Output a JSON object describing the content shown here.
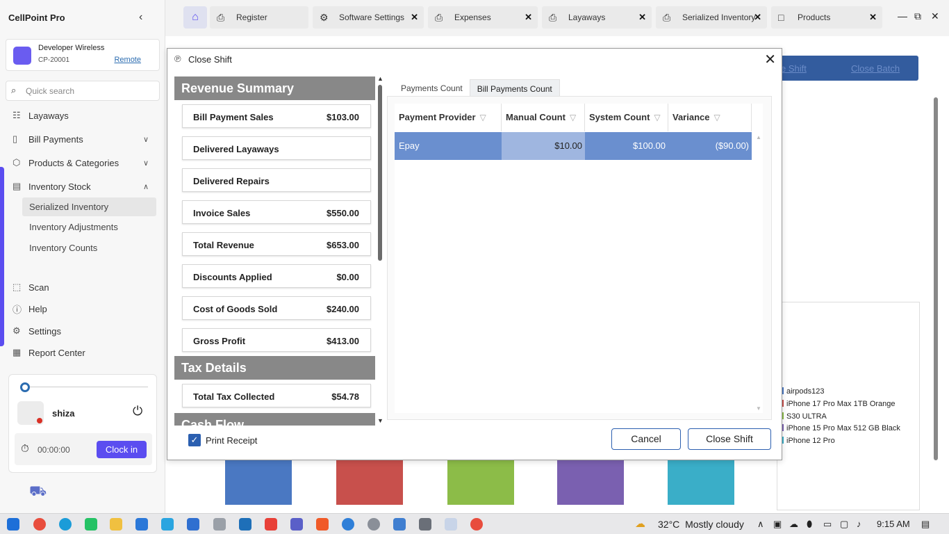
{
  "app": {
    "title": "CellPoint Pro"
  },
  "store": {
    "name": "Developer Wireless",
    "code": "CP-20001",
    "remote_label": "Remote"
  },
  "search": {
    "placeholder": "Quick search"
  },
  "nav": {
    "layaways": "Layaways",
    "bill_payments": "Bill Payments",
    "products_categories": "Products & Categories",
    "inventory_stock": "Inventory Stock",
    "sub": [
      "Serialized Inventory",
      "Inventory Adjustments",
      "Inventory Counts"
    ],
    "scan": "Scan",
    "help": "Help",
    "settings": "Settings",
    "report_center": "Report Center"
  },
  "user": {
    "name": "shiza",
    "timer": "00:00:00",
    "clock_in": "Clock in"
  },
  "tabs": [
    {
      "label": "Register"
    },
    {
      "label": "Software Settings"
    },
    {
      "label": "Expenses"
    },
    {
      "label": "Layaways"
    },
    {
      "label": "Serialized Inventory"
    },
    {
      "label": "Products"
    }
  ],
  "background": {
    "bar_links": [
      "e Shift",
      "Close Batch"
    ],
    "legend": [
      "airpods123",
      "iPhone 17 Pro Max 1TB Orange",
      "S30 ULTRA",
      "iPhone 15 Pro Max 512 GB Black",
      "iPhone 12 Pro"
    ],
    "legend_colors": [
      "#4a78c2",
      "#c8504c",
      "#8cbc48",
      "#7a60b0",
      "#3aaec8"
    ]
  },
  "dialog": {
    "title": "Close Shift",
    "revenue_header": "Revenue Summary",
    "revenue": [
      {
        "label": "Bill Payment Sales",
        "value": "$103.00"
      },
      {
        "label": "Delivered Layaways",
        "value": ""
      },
      {
        "label": "Delivered Repairs",
        "value": ""
      },
      {
        "label": "Invoice Sales",
        "value": "$550.00"
      },
      {
        "label": "Total Revenue",
        "value": "$653.00"
      },
      {
        "label": "Discounts Applied",
        "value": "$0.00"
      },
      {
        "label": "Cost of Goods Sold",
        "value": "$240.00"
      },
      {
        "label": "Gross Profit",
        "value": "$413.00"
      }
    ],
    "tax_header": "Tax Details",
    "tax": [
      {
        "label": "Total Tax Collected",
        "value": "$54.78"
      }
    ],
    "cash_header": "Cash Flow",
    "tabs": [
      "Payments Count",
      "Bill Payments Count"
    ],
    "active_tab": "Bill Payments Count",
    "grid": {
      "columns": [
        "Payment Provider",
        "Manual Count",
        "System Count",
        "Variance"
      ],
      "rows": [
        {
          "provider": "Epay",
          "manual": "$10.00",
          "system": "$100.00",
          "variance": "($90.00)"
        }
      ]
    },
    "print_receipt_label": "Print Receipt",
    "print_receipt_checked": true,
    "cancel_label": "Cancel",
    "close_label": "Close Shift"
  },
  "taskbar": {
    "temperature": "32°C",
    "weather": "Mostly cloudy",
    "time": "9:15 AM"
  },
  "colors": {
    "accent": "#5b4df0",
    "selection": "#6a8fcf",
    "selection_cell": "#9fb6e0",
    "section_header": "#888888"
  }
}
